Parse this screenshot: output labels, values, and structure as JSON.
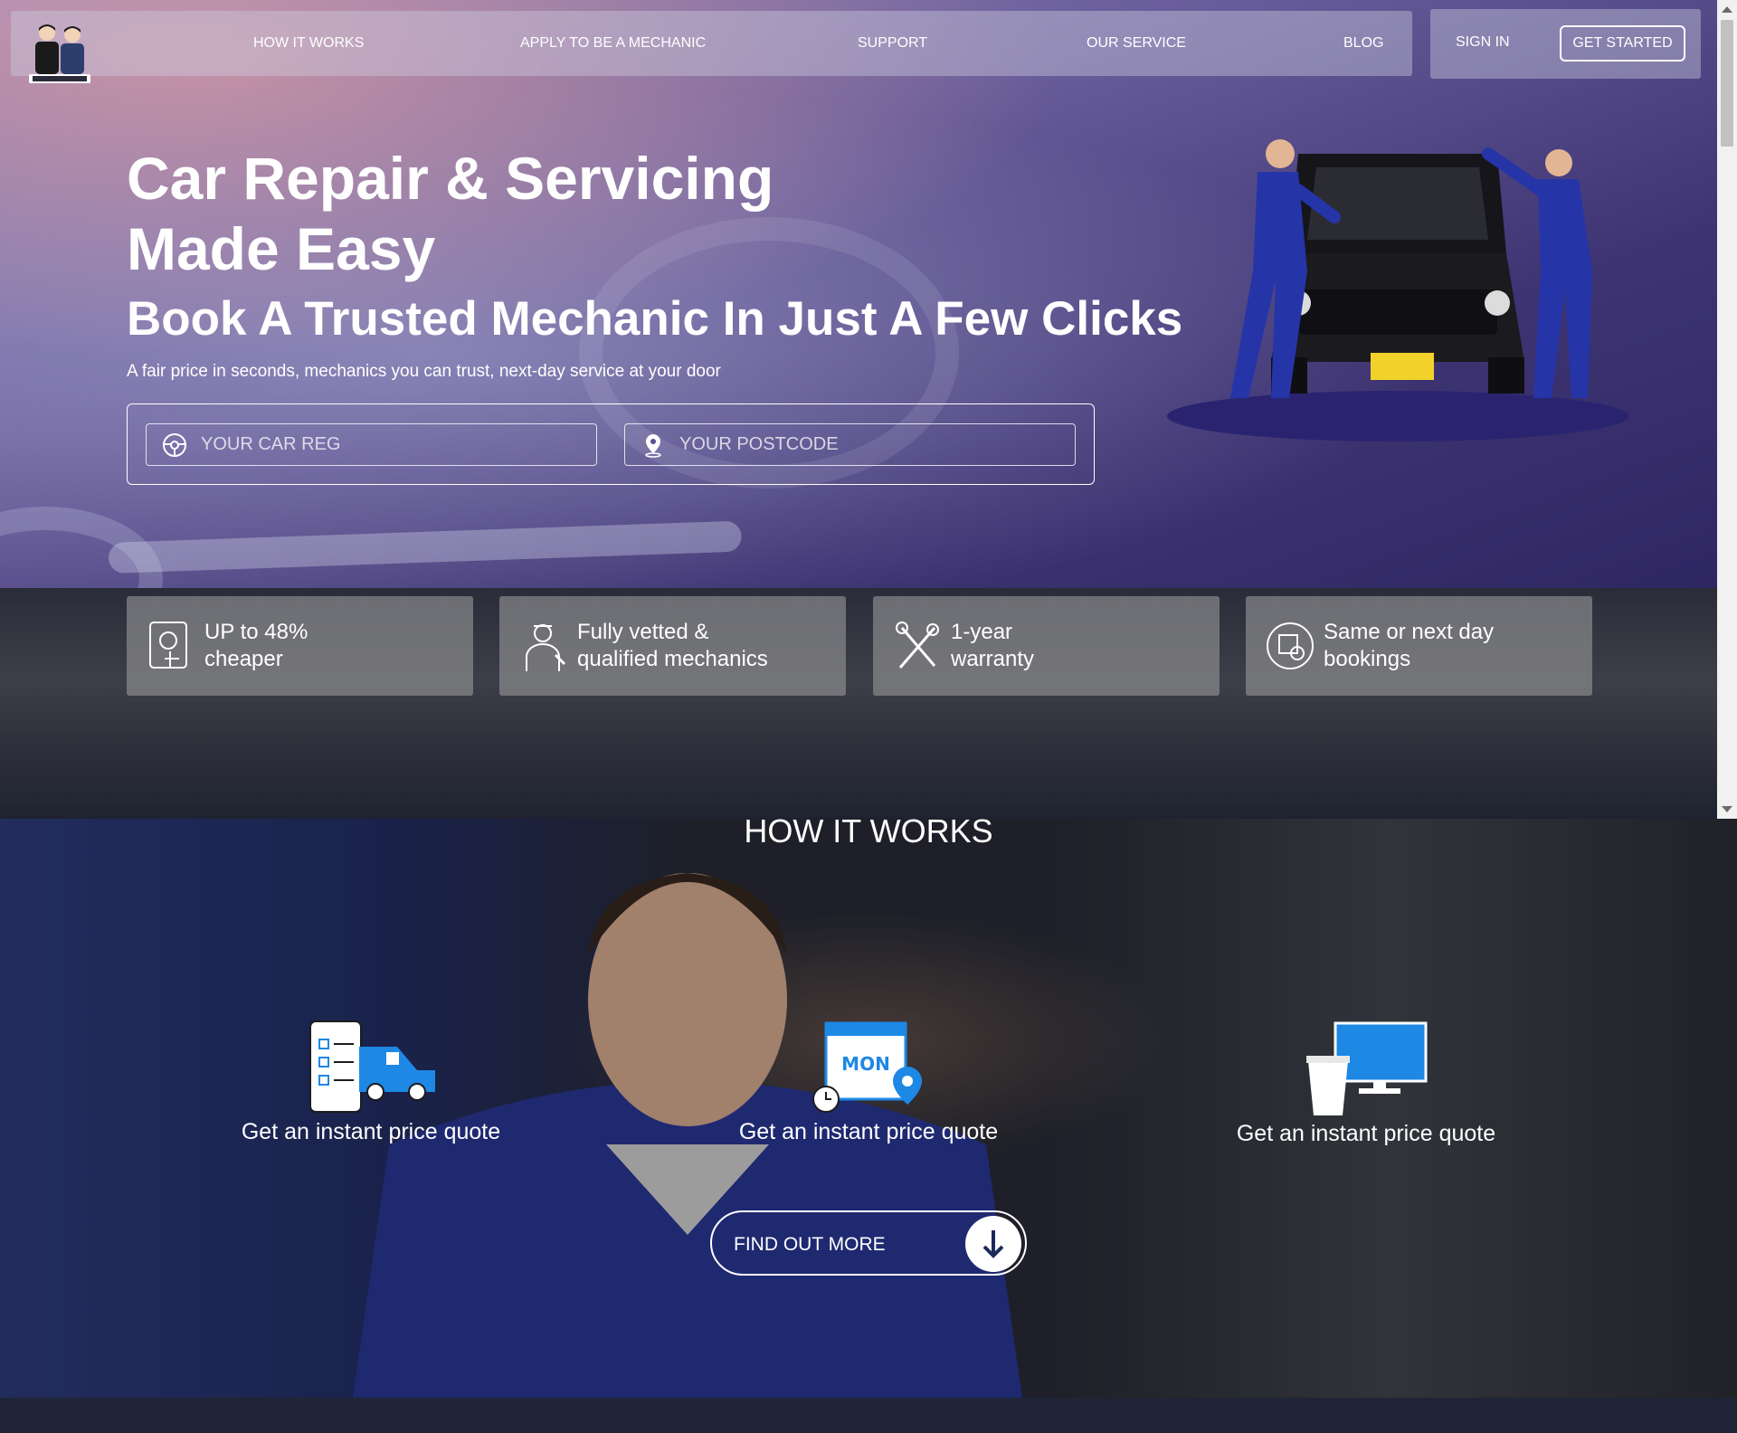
{
  "nav": {
    "links": [
      "HOW IT WORKS",
      "APPLY TO BE A MECHANIC",
      "SUPPORT",
      "OUR SERVICE",
      "BLOG"
    ],
    "sign_in": "SIGN IN",
    "get_started": "GET STARTED"
  },
  "hero": {
    "title": "Car Repair & Servicing Made Easy",
    "subtitle": "Book A Trusted Mechanic In Just A Few Clicks",
    "tagline": "A fair price in seconds, mechanics you can trust, next-day service at your door",
    "car_reg_placeholder": "YOUR CAR REG",
    "postcode_placeholder": "YOUR POSTCODE"
  },
  "features": [
    {
      "text": "UP to 48% cheaper",
      "icon": "phone-tap-icon"
    },
    {
      "text": "Fully vetted & qualified mechanics",
      "icon": "mechanic-icon"
    },
    {
      "text": "1-year warranty",
      "icon": "tools-icon"
    },
    {
      "text": "Same or next day bookings",
      "icon": "calendar-clock-icon"
    }
  ],
  "how_it_works": {
    "title": "HOW IT WORKS",
    "steps": [
      {
        "label": "Get an instant price quote",
        "icon": "checklist-van-icon"
      },
      {
        "label": "Get an instant price quote",
        "icon": "calendar-location-icon",
        "calendar_text": "MON"
      },
      {
        "label": "Get an instant price quote",
        "icon": "monitor-cup-icon"
      }
    ],
    "find_out_more": "FIND OUT MORE"
  },
  "colors": {
    "hero_overlay": "#5a4f93",
    "accent_blue": "#1e88e5",
    "footer": "#1f2536"
  }
}
